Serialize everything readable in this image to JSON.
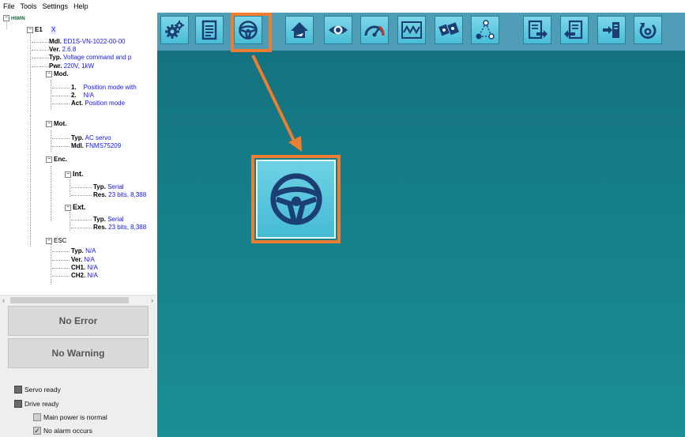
{
  "menu": [
    "File",
    "Tools",
    "Settings",
    "Help"
  ],
  "tree": {
    "root": "HIWIN",
    "device": {
      "label": "E1",
      "badge": "X"
    },
    "mdl": {
      "k": "Mdl.",
      "v": "ED1S-VN-1022-00-00"
    },
    "ver": {
      "k": "Ver.",
      "v": "2.6.8"
    },
    "typ": {
      "k": "Typ.",
      "v": "Voltage command and p"
    },
    "pwr": {
      "k": "Pwr.",
      "v": "220V, 1kW"
    },
    "mod": "Mod.",
    "mod1": {
      "k": "1.",
      "v": "Position mode with"
    },
    "mod2": {
      "k": "2.",
      "v": "N/A"
    },
    "modact": {
      "k": "Act.",
      "v": "Position mode"
    },
    "mot": "Mot.",
    "mottyp": {
      "k": "Typ.",
      "v": "AC servo"
    },
    "motmdl": {
      "k": "Mdl.",
      "v": "FNMS75209"
    },
    "enc": "Enc.",
    "int": "Int.",
    "inttyp": {
      "k": "Typ.",
      "v": "Serial"
    },
    "intres": {
      "k": "Res.",
      "v": "23 bits, 8,388"
    },
    "ext": "Ext.",
    "exttyp": {
      "k": "Typ.",
      "v": "Serial"
    },
    "extres": {
      "k": "Res.",
      "v": "23 bits, 8,388"
    },
    "esc": "ESC",
    "esctyp": {
      "k": "Typ.",
      "v": "N/A"
    },
    "escver": {
      "k": "Ver.",
      "v": "N/A"
    },
    "ch1": {
      "k": "CH1.",
      "v": "N/A"
    },
    "ch2": {
      "k": "CH2.",
      "v": "N/A"
    }
  },
  "status": {
    "error": "No Error",
    "warning": "No Warning"
  },
  "indicators": {
    "servo_ready": "Servo ready",
    "drive_ready": "Drive ready",
    "main_power": "Main power is normal",
    "no_alarm": "No alarm occurs"
  },
  "toolbar_icons": [
    "gear-icon",
    "document-icon",
    "steering-wheel-icon",
    "home-icon",
    "eye-icon",
    "gauge-icon",
    "scope-icon",
    "tuning-icon",
    "network-icon",
    "export-icon",
    "import-icon",
    "download-icon",
    "reset-icon"
  ],
  "colors": {
    "highlight": "#ed7d31",
    "toolbar": "#4f9cb6",
    "main_bg": "#167f8a",
    "value_text": "#1515d8"
  }
}
